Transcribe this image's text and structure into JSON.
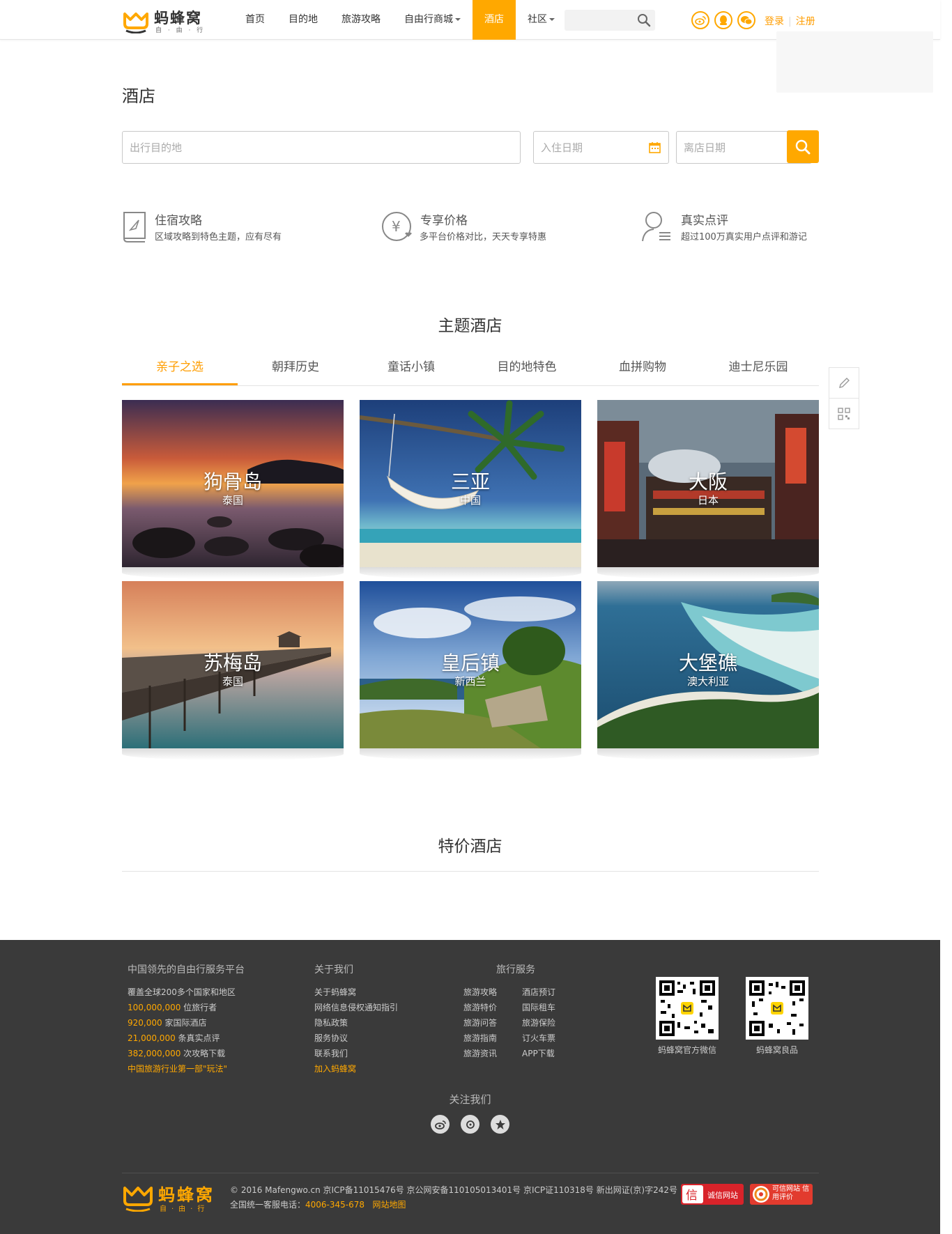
{
  "header": {
    "logo_text": "蚂蜂窝",
    "logo_sub": "自 · 由 · 行",
    "nav": [
      {
        "label": "首页",
        "dropdown": false,
        "active": false
      },
      {
        "label": "目的地",
        "dropdown": false,
        "active": false
      },
      {
        "label": "旅游攻略",
        "dropdown": false,
        "active": false
      },
      {
        "label": "自由行商城",
        "dropdown": true,
        "active": false
      },
      {
        "label": "酒店",
        "dropdown": false,
        "active": true
      },
      {
        "label": "社区",
        "dropdown": true,
        "active": false
      }
    ],
    "search_placeholder": "",
    "login": "登录",
    "register": "注册"
  },
  "page": {
    "title": "酒店"
  },
  "search": {
    "destination_placeholder": "出行目的地",
    "checkin_placeholder": "入住日期",
    "checkout_placeholder": "离店日期"
  },
  "features": [
    {
      "title": "住宿攻略",
      "desc": "区域攻略到特色主题，应有尽有",
      "icon": "guide-book-icon"
    },
    {
      "title": "专享价格",
      "desc": "多平台价格对比，天天专享特惠",
      "icon": "yuan-price-icon"
    },
    {
      "title": "真实点评",
      "desc": "超过100万真实用户点评和游记",
      "icon": "user-review-icon"
    }
  ],
  "themes": {
    "title": "主题酒店",
    "tabs": [
      "亲子之选",
      "朝拜历史",
      "童话小镇",
      "目的地特色",
      "血拼购物",
      "迪士尼乐园"
    ],
    "active_tab": 0,
    "cards": [
      {
        "name": "狗骨岛",
        "country": "泰国"
      },
      {
        "name": "三亚",
        "country": "中国"
      },
      {
        "name": "大阪",
        "country": "日本"
      },
      {
        "name": "苏梅岛",
        "country": "泰国"
      },
      {
        "name": "皇后镇",
        "country": "新西兰"
      },
      {
        "name": "大堡礁",
        "country": "澳大利亚"
      }
    ]
  },
  "deals": {
    "title": "特价酒店"
  },
  "footer": {
    "col1": {
      "heading": "中国领先的自由行服务平台",
      "lines": [
        {
          "num": "",
          "text": "覆盖全球200多个国家和地区"
        },
        {
          "num": "100,000,000",
          "text": "位旅行者"
        },
        {
          "num": "920,000",
          "text": "家国际酒店"
        },
        {
          "num": "21,000,000",
          "text": "条真实点评"
        },
        {
          "num": "382,000,000",
          "text": "次攻略下载"
        }
      ],
      "highlight": "中国旅游行业第一部\"玩法\""
    },
    "col2": {
      "heading": "关于我们",
      "links": [
        "关于蚂蜂窝",
        "网络信息侵权通知指引",
        "隐私政策",
        "服务协议",
        "联系我们"
      ],
      "highlight": "加入蚂蜂窝"
    },
    "col3": {
      "heading": "旅行服务",
      "left": [
        "旅游攻略",
        "旅游特价",
        "旅游问答",
        "旅游指南",
        "旅游资讯"
      ],
      "right": [
        "酒店预订",
        "国际租车",
        "旅游保险",
        "订火车票",
        "APP下载"
      ]
    },
    "qr": [
      {
        "caption": "蚂蜂窝官方微信"
      },
      {
        "caption": "蚂蜂窝良品"
      }
    ],
    "follow": "关注我们",
    "logo_text": "蚂蜂窝",
    "logo_sub": "自·由·行",
    "copyright": "© 2016 Mafengwo.cn 京ICP备11015476号 京公网安备110105013401号 京ICP证110318号 新出网证(京)字242号",
    "hotline_label": "全国统一客服电话：",
    "hotline": "4006-345-678",
    "sitemap": "网站地图",
    "badge1": "诚信网站",
    "badge2": "可信网站 信用评价",
    "brand_color": "#ffa800"
  }
}
